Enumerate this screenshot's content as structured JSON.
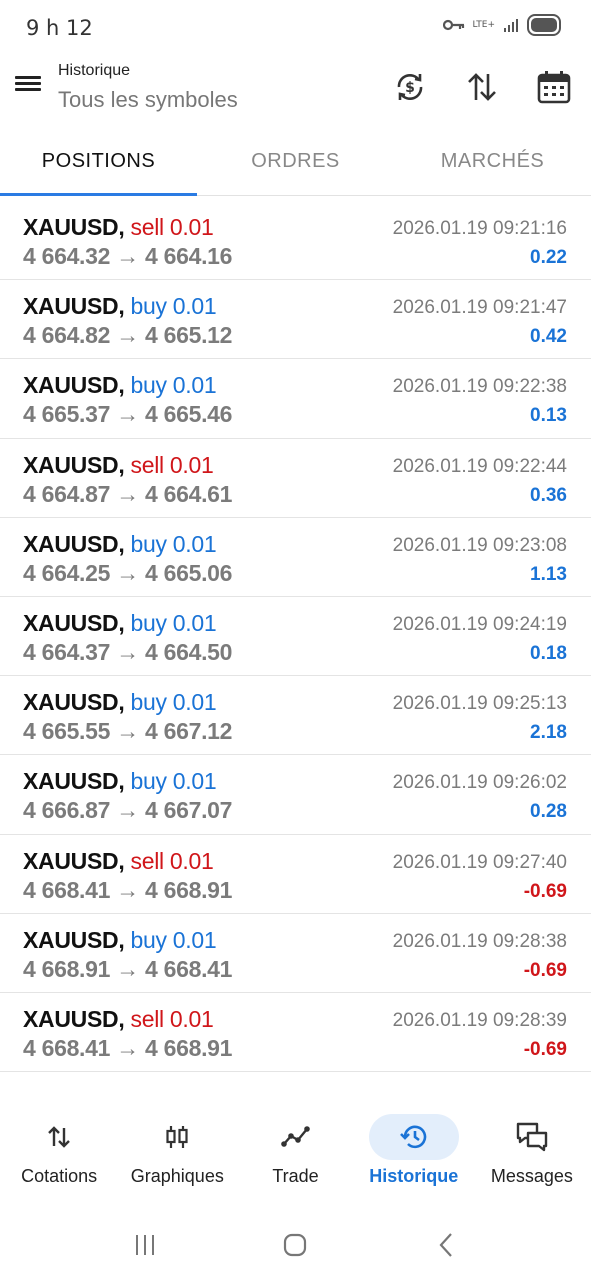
{
  "status_bar": {
    "time": "9 h 12",
    "network": "LTE+"
  },
  "app_bar": {
    "title": "Historique",
    "subtitle": "Tous les symboles"
  },
  "tabs": [
    {
      "label": "POSITIONS",
      "active": true
    },
    {
      "label": "ORDRES",
      "active": false
    },
    {
      "label": "MARCHÉS",
      "active": false
    }
  ],
  "positions": [
    {
      "symbol": "XAUUSD,",
      "side": "sell 0.01",
      "prices": "4 664.32 → 4 664.16",
      "time": "2026.01.19 09:21:16",
      "profit": "0.22"
    },
    {
      "symbol": "XAUUSD,",
      "side": "buy 0.01",
      "prices": "4 664.82 → 4 665.12",
      "time": "2026.01.19 09:21:47",
      "profit": "0.42"
    },
    {
      "symbol": "XAUUSD,",
      "side": "buy 0.01",
      "prices": "4 665.37 → 4 665.46",
      "time": "2026.01.19 09:22:38",
      "profit": "0.13"
    },
    {
      "symbol": "XAUUSD,",
      "side": "sell 0.01",
      "prices": "4 664.87 → 4 664.61",
      "time": "2026.01.19 09:22:44",
      "profit": "0.36"
    },
    {
      "symbol": "XAUUSD,",
      "side": "buy 0.01",
      "prices": "4 664.25 → 4 665.06",
      "time": "2026.01.19 09:23:08",
      "profit": "1.13"
    },
    {
      "symbol": "XAUUSD,",
      "side": "buy 0.01",
      "prices": "4 664.37 → 4 664.50",
      "time": "2026.01.19 09:24:19",
      "profit": "0.18"
    },
    {
      "symbol": "XAUUSD,",
      "side": "buy 0.01",
      "prices": "4 665.55 → 4 667.12",
      "time": "2026.01.19 09:25:13",
      "profit": "2.18"
    },
    {
      "symbol": "XAUUSD,",
      "side": "buy 0.01",
      "prices": "4 666.87 → 4 667.07",
      "time": "2026.01.19 09:26:02",
      "profit": "0.28"
    },
    {
      "symbol": "XAUUSD,",
      "side": "sell 0.01",
      "prices": "4 668.41 → 4 668.91",
      "time": "2026.01.19 09:27:40",
      "profit": "-0.69"
    },
    {
      "symbol": "XAUUSD,",
      "side": "buy 0.01",
      "prices": "4 668.91 → 4 668.41",
      "time": "2026.01.19 09:28:38",
      "profit": "-0.69"
    },
    {
      "symbol": "XAUUSD,",
      "side": "sell 0.01",
      "prices": "4 668.41 → 4 668.91",
      "time": "2026.01.19 09:28:39",
      "profit": "-0.69"
    }
  ],
  "bottom_nav": [
    {
      "label": "Cotations",
      "icon": "swap-arrows-icon",
      "active": false
    },
    {
      "label": "Graphiques",
      "icon": "candlestick-icon",
      "active": false
    },
    {
      "label": "Trade",
      "icon": "trend-line-icon",
      "active": false
    },
    {
      "label": "Historique",
      "icon": "history-icon",
      "active": true
    },
    {
      "label": "Messages",
      "icon": "chat-icon",
      "active": false
    }
  ],
  "colors": {
    "accent": "#1a73d6",
    "sell": "#d0161a",
    "buy": "#1a73d6",
    "muted": "#7b7b7b"
  }
}
